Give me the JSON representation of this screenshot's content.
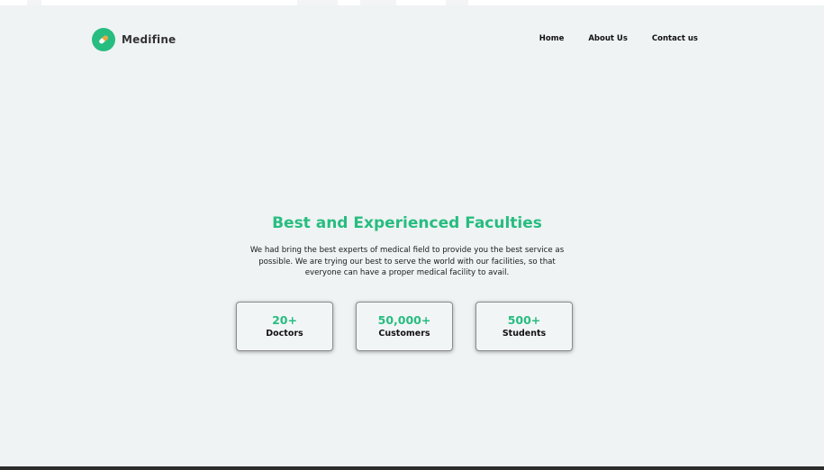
{
  "brand": {
    "name": "Medifine",
    "logo_icon": "pill-icon",
    "accent_color": "#27bd80"
  },
  "nav": {
    "items": [
      {
        "label": "Home"
      },
      {
        "label": "About Us"
      },
      {
        "label": "Contact us"
      }
    ]
  },
  "hero": {
    "title": "Best and Experienced Faculties",
    "description": "We had bring the best experts of medical field to provide you the best service as possible. We are trying our best to serve the world with our facilities, so that everyone can have a proper medical facility to avail."
  },
  "stats": [
    {
      "value": "20+",
      "label": "Doctors"
    },
    {
      "value": "50,000+",
      "label": "Customers"
    },
    {
      "value": "500+",
      "label": "Students"
    }
  ]
}
